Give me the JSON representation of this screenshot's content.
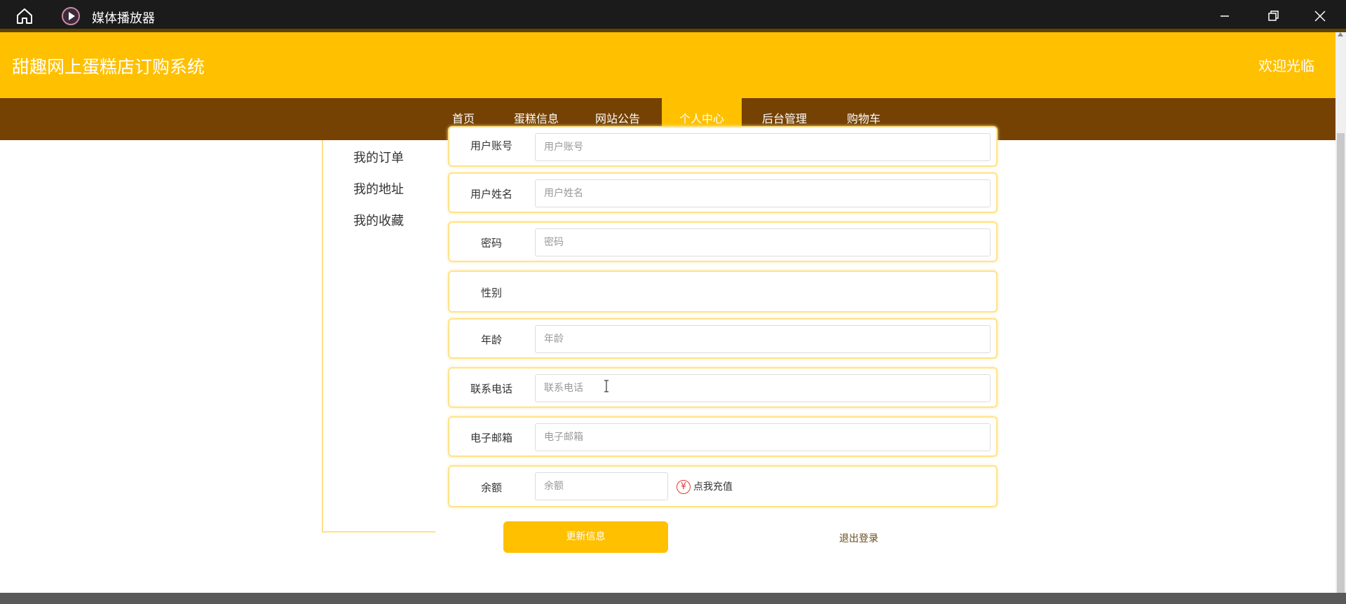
{
  "window": {
    "title": "媒体播放器",
    "icons": [
      "home-icon",
      "media-player-icon",
      "minimize-icon",
      "maximize-icon",
      "close-icon"
    ]
  },
  "header": {
    "site_title": "甜趣网上蛋糕店订购系统",
    "welcome": "欢迎光临"
  },
  "nav": {
    "items": [
      "首页",
      "蛋糕信息",
      "网站公告",
      "个人中心",
      "后台管理",
      "购物车"
    ],
    "active": "个人中心"
  },
  "sidebar": {
    "items": [
      "我的订单",
      "我的地址",
      "我的收藏"
    ]
  },
  "form": {
    "account": {
      "label": "用户账号",
      "placeholder": "用户账号"
    },
    "name": {
      "label": "用户姓名",
      "placeholder": "用户姓名"
    },
    "password": {
      "label": "密码",
      "placeholder": "密码"
    },
    "gender": {
      "label": "性别"
    },
    "age": {
      "label": "年龄",
      "placeholder": "年龄"
    },
    "phone": {
      "label": "联系电话",
      "placeholder": "联系电话"
    },
    "email": {
      "label": "电子邮箱",
      "placeholder": "电子邮箱"
    },
    "balance": {
      "label": "余额",
      "placeholder": "余额",
      "recharge": "点我充值",
      "currency_symbol": "¥"
    }
  },
  "actions": {
    "update": "更新信息",
    "logout": "退出登录"
  },
  "colors": {
    "accent": "#ffc000",
    "nav_bg": "#754203",
    "titlebar_bg": "#1b1b1b"
  }
}
